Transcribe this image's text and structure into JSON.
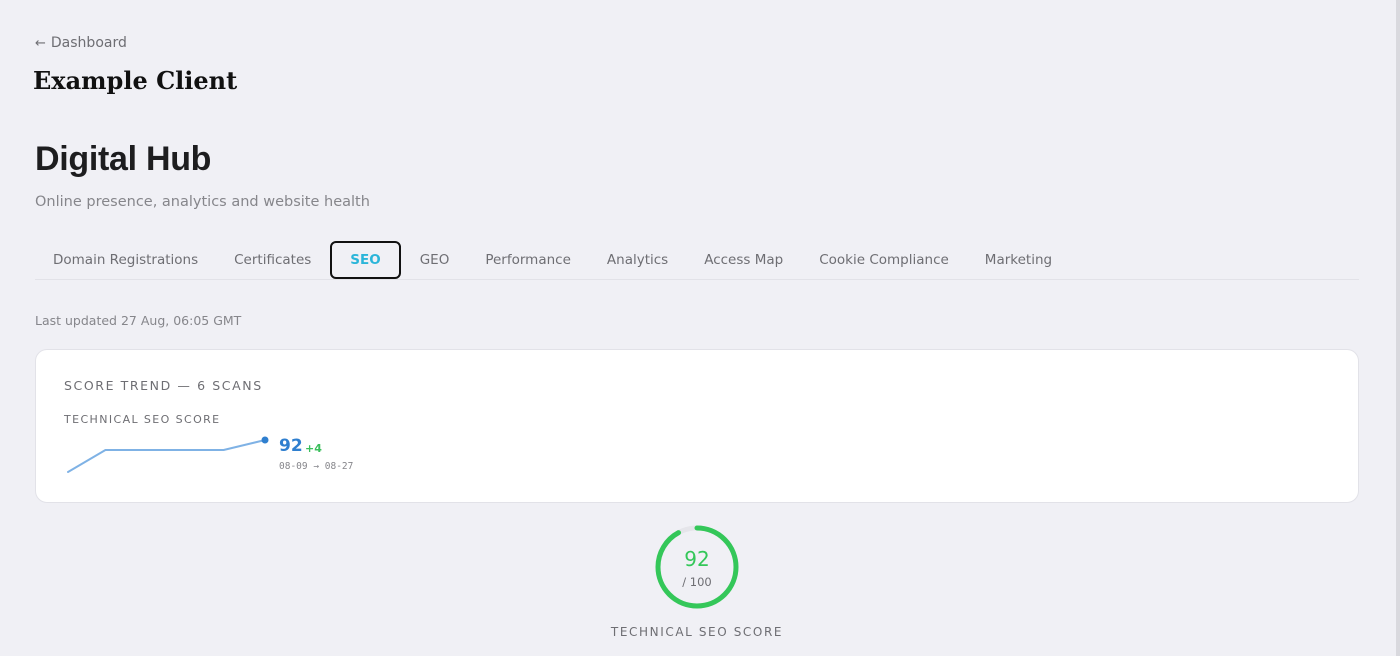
{
  "nav": {
    "back_arrow": "←",
    "back_label": "Dashboard"
  },
  "client": {
    "name": "Example Client"
  },
  "page": {
    "title": "Digital Hub",
    "subtitle": "Online presence, analytics and website health"
  },
  "tabs": [
    {
      "label": "Domain Registrations",
      "active": false
    },
    {
      "label": "Certificates",
      "active": false
    },
    {
      "label": "SEO",
      "active": true
    },
    {
      "label": "GEO",
      "active": false
    },
    {
      "label": "Performance",
      "active": false
    },
    {
      "label": "Analytics",
      "active": false
    },
    {
      "label": "Access Map",
      "active": false
    },
    {
      "label": "Cookie Compliance",
      "active": false
    },
    {
      "label": "Marketing",
      "active": false
    }
  ],
  "status": {
    "last_updated": "Last updated 27 Aug, 06:05 GMT"
  },
  "trend_card": {
    "title": "SCORE TREND — 6 SCANS",
    "metric": {
      "label": "TECHNICAL SEO SCORE",
      "value": "92",
      "delta": "+4",
      "range": "08-09 → 08-27",
      "trend": [
        88,
        92,
        92,
        92,
        92,
        92
      ],
      "trend_min": 88,
      "trend_max": 92
    }
  },
  "score_gauge": {
    "value": "92",
    "max": "/ 100",
    "fraction": 0.92,
    "label": "TECHNICAL SEO SCORE"
  },
  "colors": {
    "accent_tab": "#2bb5d9",
    "metric_blue": "#2f7fcf",
    "sparkline": "#7fb2e5",
    "delta_green": "#3bbf5c",
    "gauge_green": "#34c759",
    "gauge_track": "#e5e5ea"
  }
}
